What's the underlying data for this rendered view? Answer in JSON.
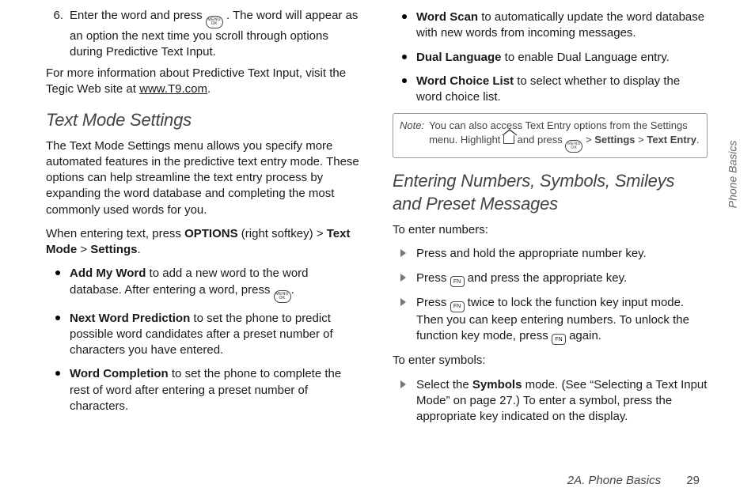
{
  "left": {
    "step6": {
      "num": "6.",
      "text_a": "Enter the word and press ",
      "text_b": ". The word will appear as an option the next time you scroll through options during Predictive Text Input."
    },
    "more_info_a": "For more information about Predictive Text Input, visit the Tegic Web site at ",
    "more_info_link": "www.T9.com",
    "more_info_b": ".",
    "heading": "Text Mode Settings",
    "intro": "The Text Mode Settings menu allows you specify more automated features in the predictive text entry mode. These options can help streamline the text entry process by expanding the word database and completing the most commonly used words for you.",
    "path_a": "When entering text, press ",
    "path_options": "OPTIONS",
    "path_b": " (right softkey) ",
    "path_textmode": "Text Mode",
    "path_settings": "Settings",
    "gt": ">",
    "period": ".",
    "bullets": {
      "add_word_b": "Add My Word",
      "add_word_a": " to add a new word to the word database. After entering a word, press ",
      "add_word_c": ".",
      "next_b": "Next Word Prediction",
      "next_a": " to set the phone to predict possible word candidates after a preset number of characters you have entered.",
      "comp_b": "Word Completion",
      "comp_a": " to set the phone to complete the rest of word after entering a preset number of characters."
    }
  },
  "right": {
    "bullets": {
      "scan_b": "Word Scan",
      "scan_a": " to automatically update the word database with new words from incoming messages.",
      "dual_b": "Dual Language",
      "dual_a": " to enable Dual Language entry.",
      "choice_b": "Word Choice List",
      "choice_a": " to select whether to display the word choice list."
    },
    "note": {
      "label": "Note:",
      "a": "You can also access Text Entry options from the Settings menu. Highlight ",
      "b": " and press ",
      "gt": ">",
      "settings": "Settings",
      "text_entry": "Text Entry",
      "period": "."
    },
    "heading": "Entering Numbers, Symbols, Smileys and Preset Messages",
    "numbers_label": "To enter numbers:",
    "numbers": {
      "a1": "Press and hold the appropriate number key.",
      "b1": "Press ",
      "b2": " and press the appropriate key.",
      "c1": "Press ",
      "c2": " twice to lock the function key input mode. Then you can keep entering numbers. To unlock the function key mode, press ",
      "c3": " again."
    },
    "symbols_label": "To enter symbols:",
    "symbols": {
      "a1": "Select the ",
      "a_bold": "Symbols",
      "a2": " mode. (See “Selecting a Text Input Mode” on page 27.) To enter a symbol, press the appropriate key indicated on the display."
    }
  },
  "keys": {
    "menu_top": "MENU",
    "menu_bot": "OK",
    "fn": "FN"
  },
  "side_tab": "Phone Basics",
  "footer_section": "2A. Phone Basics",
  "footer_page": "29"
}
